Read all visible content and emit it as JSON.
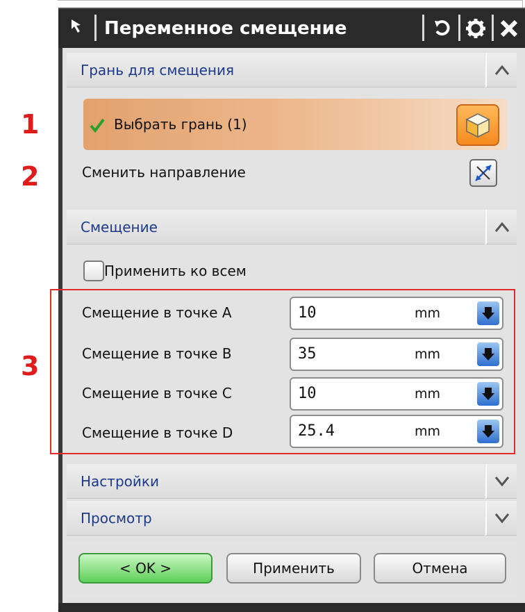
{
  "dialog": {
    "title": "Переменное смещение"
  },
  "annotations": [
    "1",
    "2",
    "3"
  ],
  "section_face": {
    "header": "Грань для смещения",
    "select_face_label": "Выбрать грань (1)",
    "reverse_direction_label": "Сменить направление"
  },
  "section_offset": {
    "header": "Смещение",
    "apply_all_label": "Применить ко всем",
    "apply_all_checked": false,
    "rows": [
      {
        "label": "Смещение в точке A",
        "value": "10",
        "unit": "mm"
      },
      {
        "label": "Смещение в точке B",
        "value": "35",
        "unit": "mm"
      },
      {
        "label": "Смещение в точке C",
        "value": "10",
        "unit": "mm"
      },
      {
        "label": "Смещение в точке D",
        "value": "25.4",
        "unit": "mm"
      }
    ]
  },
  "section_settings": {
    "header": "Настройки"
  },
  "section_preview": {
    "header": "Просмотр"
  },
  "buttons": {
    "ok": "< OK >",
    "apply": "Применить",
    "cancel": "Отмена"
  },
  "colors": {
    "titlebar": "#2a2a2a",
    "header_text": "#1d3a8a",
    "selection_highlight": "#e9ad7c",
    "annotation_red": "#e01b1b",
    "ok_button": "#5fd05a"
  },
  "icons": [
    "pin-icon",
    "reset-icon",
    "gear-icon",
    "close-icon",
    "chevron-up-icon",
    "chevron-down-icon",
    "checkmark-icon",
    "cube-icon",
    "reverse-direction-icon",
    "dropdown-arrow-icon"
  ]
}
